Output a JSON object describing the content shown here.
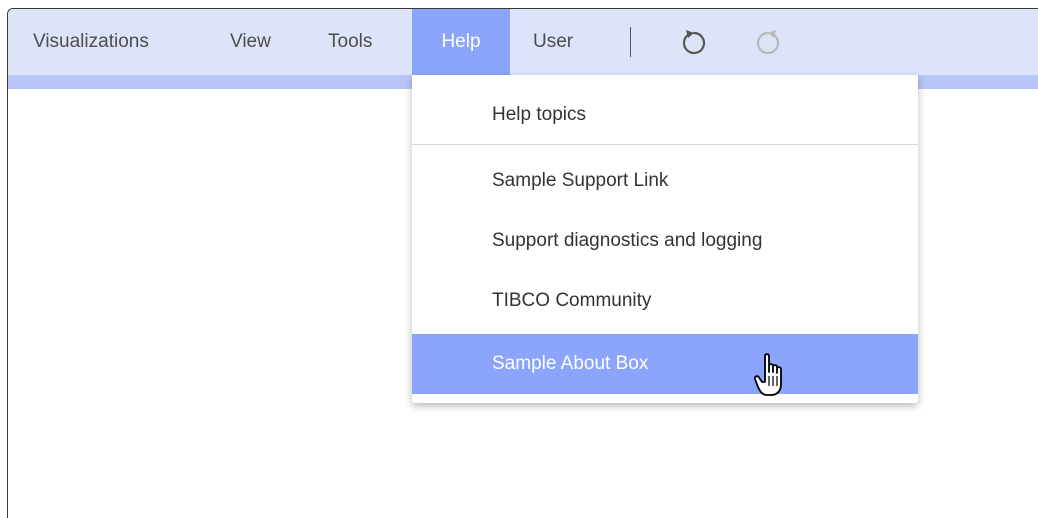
{
  "menubar": {
    "items": [
      {
        "label": "Visualizations"
      },
      {
        "label": "View"
      },
      {
        "label": "Tools"
      },
      {
        "label": "Help",
        "active": true
      },
      {
        "label": "User"
      }
    ],
    "undo_icon": "undo-icon",
    "redo_icon": "redo-icon"
  },
  "help_menu": {
    "items": [
      {
        "label": "Help topics"
      },
      {
        "label": "Sample Support Link"
      },
      {
        "label": "Support diagnostics and logging"
      },
      {
        "label": "TIBCO Community"
      },
      {
        "label": "Sample About Box",
        "highlighted": true
      }
    ]
  },
  "colors": {
    "menubar_bg": "#dde4fa",
    "accent": "#8aa5fb",
    "strip": "#b7c6f6"
  },
  "cursor_icon": "hand-pointer-icon"
}
